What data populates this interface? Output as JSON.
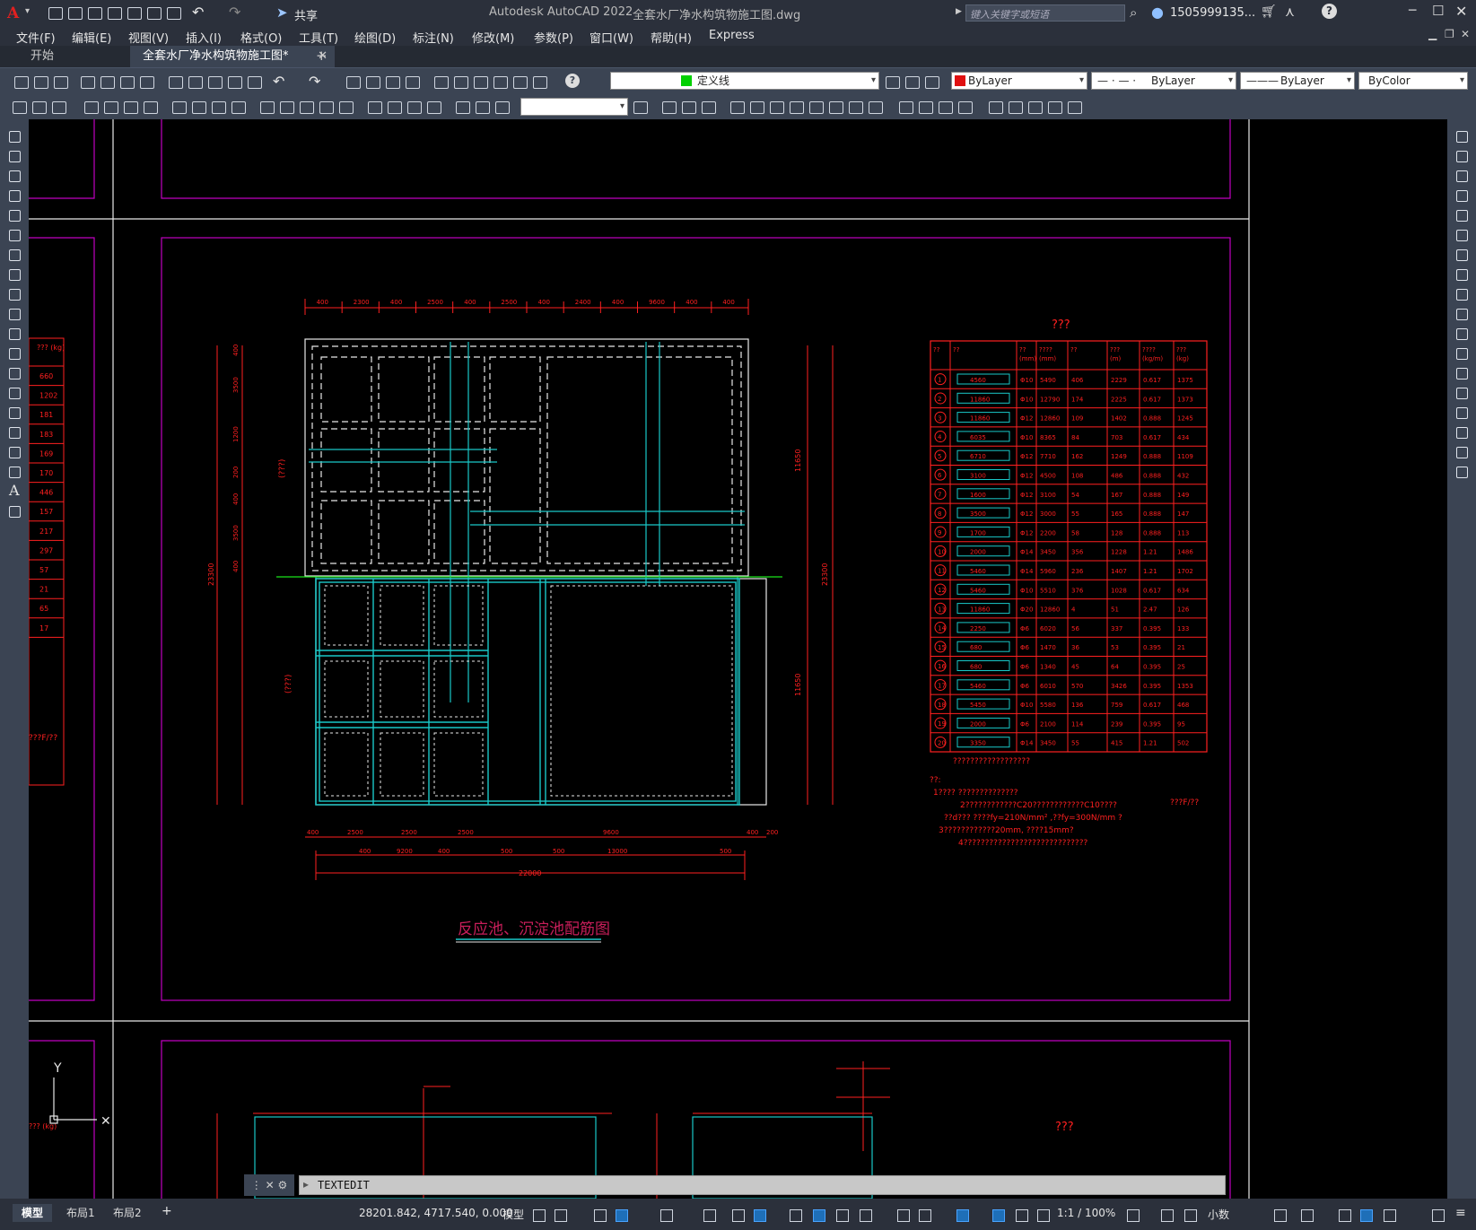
{
  "titlebar": {
    "app_title": "Autodesk AutoCAD 2022",
    "file_title": "全套水厂净水构筑物施工图.dwg",
    "share_label": "共享",
    "search_placeholder": "键入关键字或短语",
    "user": "1505999135..."
  },
  "menu": [
    "文件(F)",
    "编辑(E)",
    "视图(V)",
    "插入(I)",
    "格式(O)",
    "工具(T)",
    "绘图(D)",
    "标注(N)",
    "修改(M)",
    "参数(P)",
    "窗口(W)",
    "帮助(H)",
    "Express"
  ],
  "tabs": {
    "start": "开始",
    "doc": "全套水厂净水构筑物施工图*",
    "add": "+"
  },
  "properties": {
    "layer": "定义线",
    "color": "ByLayer",
    "linetype": "ByLayer",
    "lineweight": "ByLayer",
    "plotstyle": "ByColor"
  },
  "drawing": {
    "title": "反应池、沉淀池配筋图",
    "table_title": "???",
    "table_headers": [
      "??",
      "??",
      "??\n(mm)",
      "????\n(mm)",
      "??",
      "???\n(m)",
      "????\n(kg/m)",
      "???\n(kg)"
    ],
    "table_rows": [
      [
        "1",
        "4560",
        "Φ10",
        "5490",
        "406",
        "2229",
        "0.617",
        "1375"
      ],
      [
        "2",
        "11860",
        "Φ10",
        "12790",
        "174",
        "2225",
        "0.617",
        "1373"
      ],
      [
        "3",
        "11860",
        "Φ12",
        "12860",
        "109",
        "1402",
        "0.888",
        "1245"
      ],
      [
        "4",
        "6035",
        "Φ10",
        "8365",
        "84",
        "703",
        "0.617",
        "434"
      ],
      [
        "5",
        "6710",
        "Φ12",
        "7710",
        "162",
        "1249",
        "0.888",
        "1109"
      ],
      [
        "6",
        "3100",
        "Φ12",
        "4500",
        "108",
        "486",
        "0.888",
        "432"
      ],
      [
        "7",
        "1600",
        "Φ12",
        "3100",
        "54",
        "167",
        "0.888",
        "149"
      ],
      [
        "8",
        "3500",
        "Φ12",
        "3000",
        "55",
        "165",
        "0.888",
        "147"
      ],
      [
        "9",
        "1700",
        "Φ12",
        "2200",
        "58",
        "128",
        "0.888",
        "113"
      ],
      [
        "10",
        "2000",
        "Φ14",
        "3450",
        "356",
        "1228",
        "1.21",
        "1486"
      ],
      [
        "11",
        "5460",
        "Φ14",
        "5960",
        "236",
        "1407",
        "1.21",
        "1702"
      ],
      [
        "12",
        "5460",
        "Φ10",
        "5510",
        "376",
        "1028",
        "0.617",
        "634"
      ],
      [
        "13",
        "11860",
        "Φ20",
        "12860",
        "4",
        "51",
        "2.47",
        "126"
      ],
      [
        "14",
        "2250",
        "Φ6",
        "6020",
        "56",
        "337",
        "0.395",
        "133"
      ],
      [
        "15",
        "680",
        "Φ6",
        "1470",
        "36",
        "53",
        "0.395",
        "21"
      ],
      [
        "16",
        "680",
        "Φ6",
        "1340",
        "45",
        "64",
        "0.395",
        "25"
      ],
      [
        "17",
        "5460",
        "Φ6",
        "6010",
        "570",
        "3426",
        "0.395",
        "1353"
      ],
      [
        "18",
        "5450",
        "Φ10",
        "5580",
        "136",
        "759",
        "0.617",
        "468"
      ],
      [
        "19",
        "2000",
        "Φ6",
        "2100",
        "114",
        "239",
        "0.395",
        "95"
      ],
      [
        "20",
        "3350",
        "Φ14",
        "3450",
        "55",
        "415",
        "1.21",
        "502"
      ]
    ],
    "table_footer": "??????????????????",
    "notes": [
      "??:",
      "1????        ??????????????",
      "2????????????C20????????????C10????",
      "??d???      ????fy=210N/mm²  ,??fy=300N/mm   ?",
      "3????????????20mm, ????15mm?",
      "4?????????????????????????????"
    ],
    "notes_right": "???F/??",
    "left_table_head": "???\n(kg)",
    "left_table": [
      "660",
      "1202",
      "181",
      "183",
      "169",
      "170",
      "446",
      "157",
      "217",
      "297",
      "57",
      "21",
      "65",
      "17"
    ],
    "left_note": "???F/??",
    "bottom_left_label": "???\n(kg)",
    "bottom_right_label": "???",
    "dims_top": [
      "400",
      "2300",
      "400",
      "2500",
      "400",
      "2500",
      "400",
      "2400",
      "400",
      "9600",
      "400",
      "400"
    ],
    "dims_bottom": [
      "400",
      "2500",
      "2500",
      "2500",
      "9600",
      "400",
      "200"
    ],
    "dims_bottom2": [
      "400",
      "9200",
      "400",
      "500",
      "500",
      "13000",
      "500"
    ],
    "dims_total": "22000",
    "dims_left": [
      "400",
      "3500",
      "1200",
      "200",
      "400",
      "3500",
      "400"
    ],
    "dims_right_top": "11650",
    "dims_right_bottom": "11650",
    "dims_right_total": "23300",
    "dims_left_total": "23300",
    "left_label": "(???)",
    "ucs_y": "Y"
  },
  "command": {
    "text": "TEXTEDIT"
  },
  "status": {
    "model_tab": "模型",
    "layout1": "布局1",
    "layout2": "布局2",
    "add": "+",
    "coords": "28201.842, 4717.540, 0.000",
    "space": "模型",
    "scale": "1:1 / 100%",
    "units": "小数"
  },
  "colors": {
    "chrome": "#2b303b",
    "toolbar": "#3b4453",
    "drawing_red": "#ff2020",
    "frame_magenta": "#c000c0",
    "rebar_cyan": "#19c8c8"
  }
}
